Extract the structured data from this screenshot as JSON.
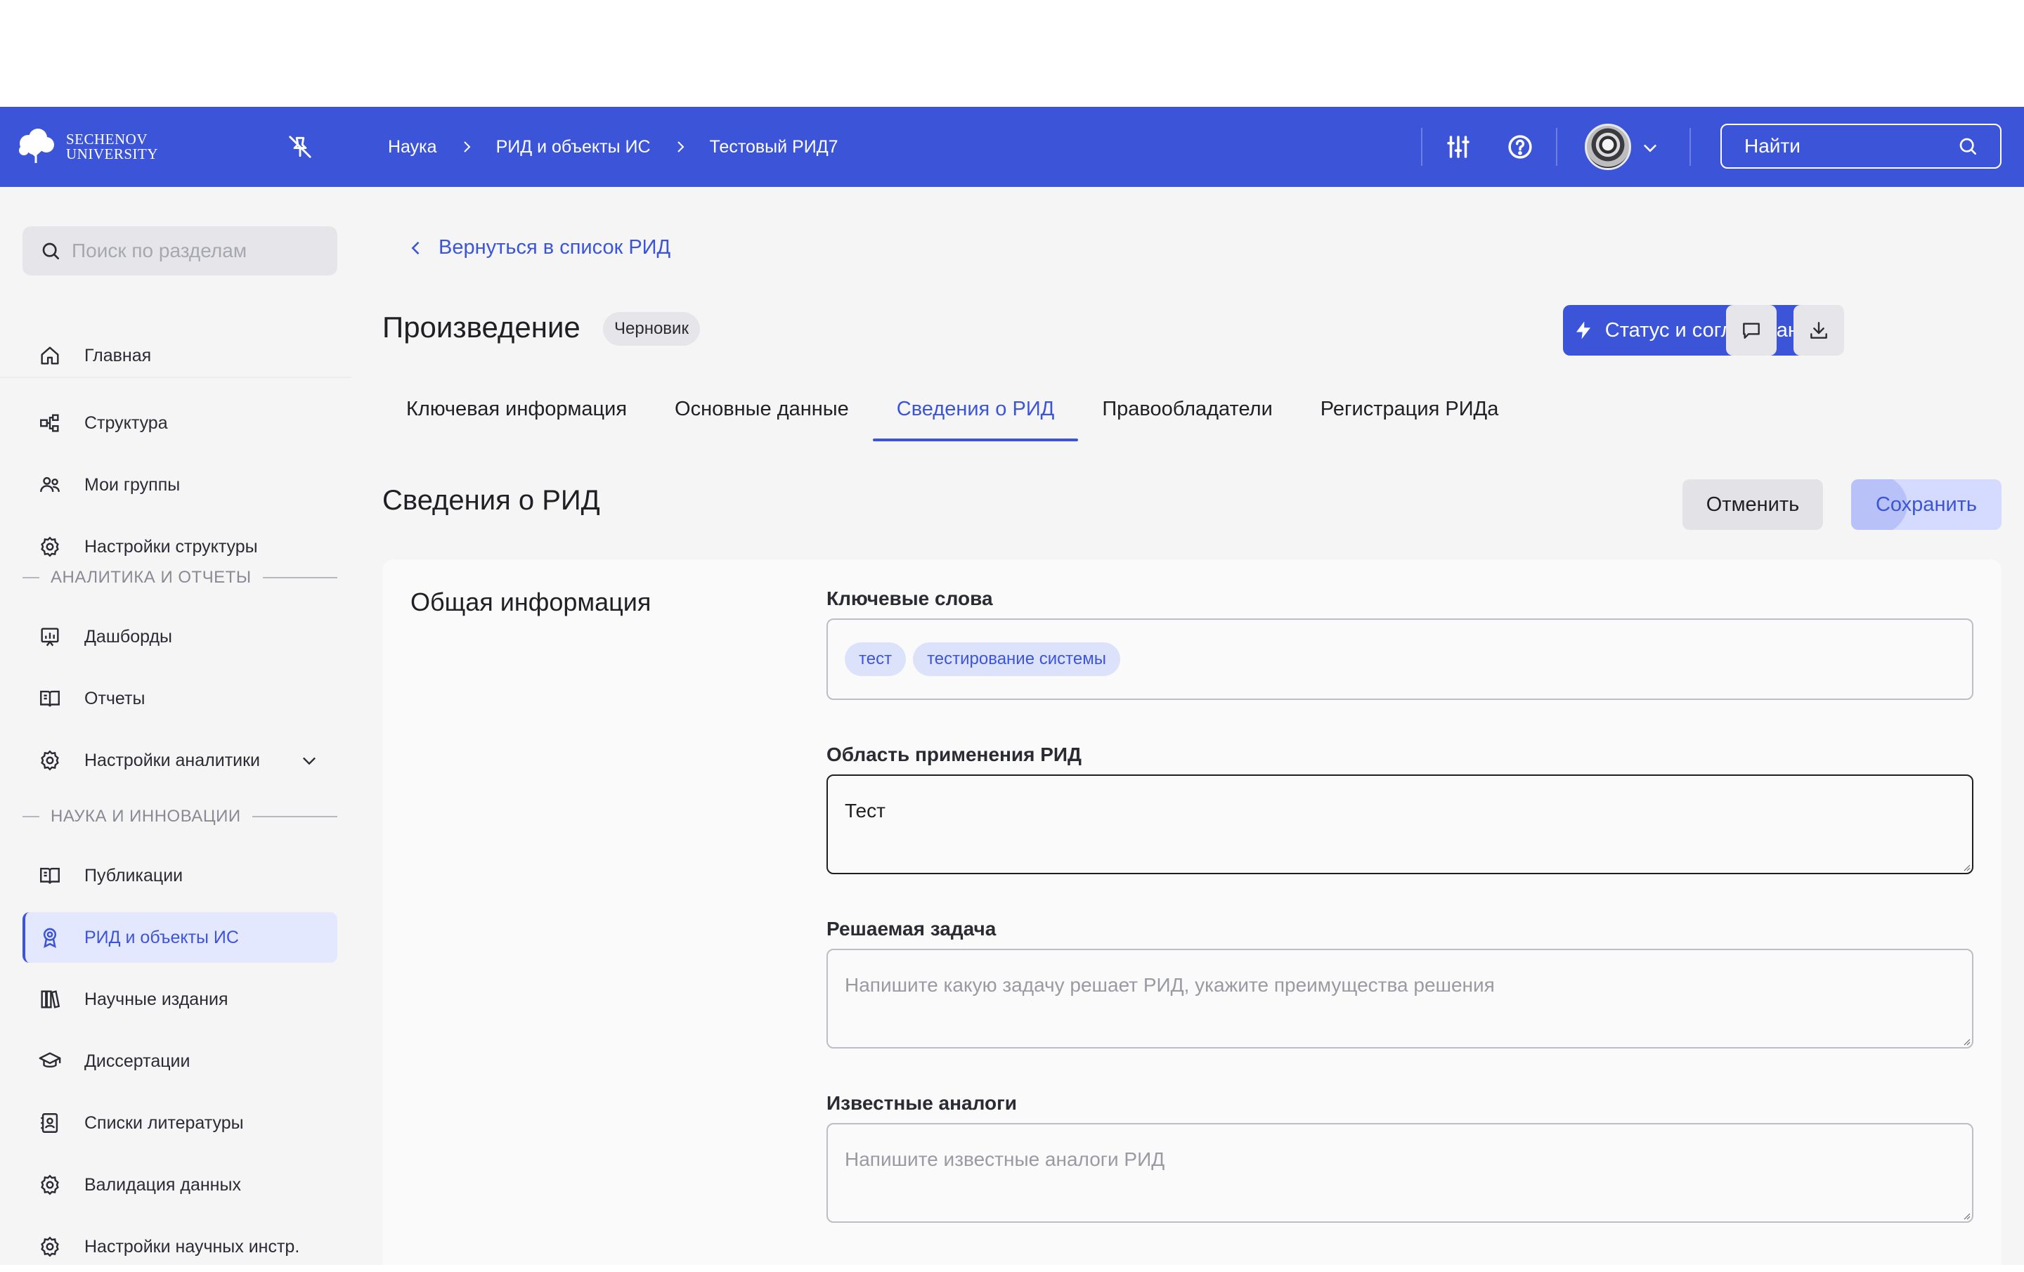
{
  "header": {
    "logo_line1": "SECHENOV",
    "logo_line2": "UNIVERSITY",
    "breadcrumb": [
      "Наука",
      "РИД и объекты ИС",
      "Тестовый РИД7"
    ],
    "search_placeholder": "Найти",
    "icons": [
      "pin-off-icon",
      "sliders-icon",
      "help-icon",
      "avatar",
      "chevron-down-icon",
      "search-icon"
    ],
    "accent_color": "#3c55d8"
  },
  "sidebar": {
    "search_placeholder": "Поиск по разделам",
    "items": [
      {
        "label": "Главная",
        "icon": "home-icon"
      },
      {
        "label": "Структура",
        "icon": "structure-icon"
      },
      {
        "label": "Мои группы",
        "icon": "groups-icon"
      },
      {
        "label": "Настройки структуры",
        "icon": "gear-icon"
      }
    ],
    "section_analytics": "АНАЛИТИКА И ОТЧЕТЫ",
    "analytics_items": [
      {
        "label": "Дашборды",
        "icon": "dashboard-icon"
      },
      {
        "label": "Отчеты",
        "icon": "book-icon"
      },
      {
        "label": "Настройки аналитики",
        "icon": "gear-icon"
      }
    ],
    "section_science": "НАУКА И ИННОВАЦИИ",
    "science_items": [
      {
        "label": "Публикации",
        "icon": "book-icon"
      },
      {
        "label": "РИД и объекты ИС",
        "icon": "award-icon",
        "active": true
      },
      {
        "label": "Научные издания",
        "icon": "library-icon"
      },
      {
        "label": "Диссертации",
        "icon": "graduation-cap-icon"
      },
      {
        "label": "Списки литературы",
        "icon": "contacts-book-icon"
      },
      {
        "label": "Валидация данных",
        "icon": "gear-icon"
      },
      {
        "label": "Настройки научных инстр.",
        "icon": "gear-icon"
      }
    ]
  },
  "main": {
    "back_link": "Вернуться в список РИД",
    "title": "Произведение",
    "badge": "Черновик",
    "status_button": "Статус и согласование",
    "tabs": [
      {
        "label": "Ключевая информация"
      },
      {
        "label": "Основные данные"
      },
      {
        "label": "Сведения о РИД",
        "active": true
      },
      {
        "label": "Правообладатели"
      },
      {
        "label": "Регистрация РИДа"
      }
    ],
    "section_title": "Сведения о РИД",
    "cancel_button": "Отменить",
    "save_button": "Сохранить",
    "card": {
      "heading": "Общая информация",
      "keywords_label": "Ключевые слова",
      "keywords": [
        "тест",
        "тестирование системы"
      ],
      "scope_label": "Область применения РИД",
      "scope_value": "Тест",
      "task_label": "Решаемая задача",
      "task_placeholder": "Напишите какую задачу решает РИД, укажите преимущества решения",
      "analogs_label": "Известные аналоги",
      "analogs_placeholder": "Напишите известные аналоги РИД"
    }
  }
}
